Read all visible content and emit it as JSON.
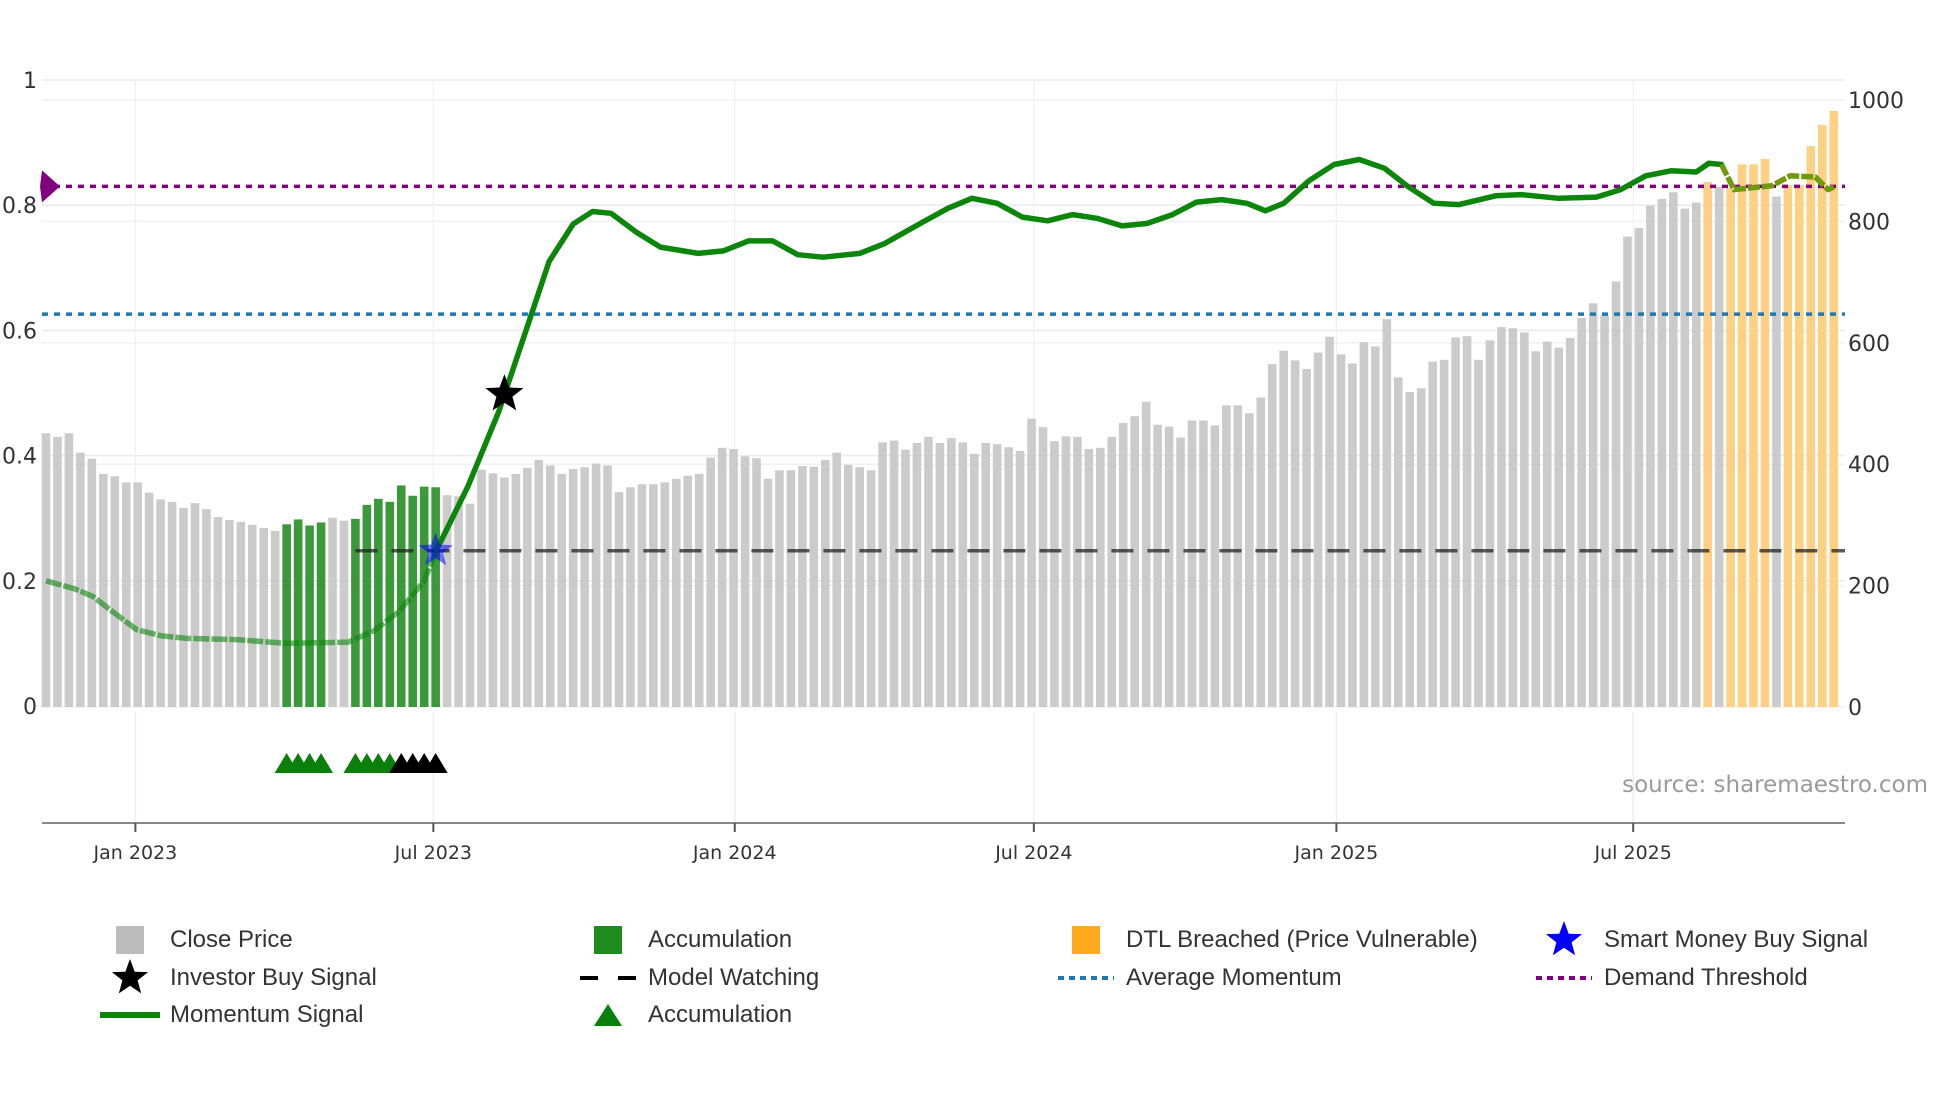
{
  "chart_data": {
    "type": "bar",
    "x_unit": "week index",
    "y_left": {
      "ticks": [
        0,
        0.2,
        0.4,
        0.6,
        0.8,
        1
      ],
      "tick_labels": [
        "0",
        "0.2",
        "0.4",
        "0.6",
        "0.8",
        "1"
      ],
      "range": [
        0,
        1
      ]
    },
    "y_right": {
      "ticks": [
        0,
        200,
        400,
        600,
        800,
        1000
      ],
      "tick_labels": [
        "0",
        "200",
        "400",
        "600",
        "800",
        "1000"
      ],
      "range": [
        0,
        1000
      ]
    },
    "x_ticks": [
      {
        "label": "Jan 2023",
        "pos": 7.8
      },
      {
        "label": "Jul 2023",
        "pos": 33.8
      },
      {
        "label": "Jan 2024",
        "pos": 60.1
      },
      {
        "label": "Jul 2024",
        "pos": 86.2
      },
      {
        "label": "Jan 2025",
        "pos": 112.6
      },
      {
        "label": "Jul 2025",
        "pos": 138.5
      }
    ],
    "close_price": [
      451,
      445,
      451,
      419,
      409,
      384,
      380,
      370,
      370,
      353,
      342,
      338,
      328,
      336,
      326,
      313,
      308,
      305,
      300,
      295,
      290,
      301,
      309,
      299,
      304,
      312,
      307,
      310,
      333,
      343,
      338,
      365,
      348,
      363,
      362,
      349,
      347,
      335,
      391,
      385,
      378,
      384,
      394,
      407,
      398,
      384,
      392,
      395,
      401,
      398,
      354,
      362,
      367,
      367,
      370,
      376,
      381,
      384,
      411,
      427,
      425,
      413,
      410,
      376,
      390,
      390,
      397,
      396,
      407,
      419,
      399,
      395,
      390,
      436,
      439,
      424,
      435,
      445,
      435,
      443,
      436,
      417,
      435,
      433,
      428,
      422,
      475,
      461,
      438,
      446,
      445,
      425,
      427,
      445,
      468,
      479,
      503,
      465,
      462,
      444,
      472,
      472,
      464,
      497,
      497,
      484,
      510,
      565,
      587,
      571,
      557,
      584,
      610,
      581,
      566,
      601,
      594,
      639,
      543,
      519,
      525,
      569,
      572,
      609,
      611,
      572,
      604,
      626,
      624,
      617,
      586,
      602,
      592,
      608,
      641,
      665,
      645,
      701,
      775,
      789,
      826,
      837,
      848,
      821,
      831,
      865,
      857,
      855,
      894,
      894,
      903,
      841,
      860,
      860,
      924,
      959,
      982
    ],
    "accumulation_bars": [
      21,
      22,
      23,
      24,
      27,
      28,
      29,
      30,
      31,
      32,
      33,
      34
    ],
    "dtl_breached_bars": [
      145,
      147,
      148,
      149,
      150,
      152,
      153,
      154,
      155,
      156
    ],
    "momentum": {
      "x": [
        0,
        2.5,
        4.1,
        5.8,
        7.9,
        10.1,
        12.3,
        16.6,
        21,
        26.4,
        28.6,
        30.8,
        33,
        34.1,
        36.8,
        39.5,
        41.7,
        43.9,
        46,
        47.7,
        49.3,
        51.5,
        53.6,
        56.9,
        59.1,
        61.3,
        63.4,
        65.6,
        67.8,
        71,
        73.2,
        76.5,
        78.7,
        80.8,
        83,
        85.2,
        87.4,
        89.6,
        91.7,
        93.9,
        96.1,
        98.3,
        100.4,
        102.6,
        104.8,
        106.4,
        108,
        110.2,
        112.4,
        114.6,
        116.8,
        118.9,
        121.1,
        123.3,
        126.5,
        128.7,
        132,
        135.3,
        137.4,
        139.6,
        141.8,
        144,
        145.1,
        146.2,
        147.3,
        149.5,
        150.6,
        152.2,
        154.4,
        155.5,
        156
      ],
      "y": [
        0.2,
        0.187,
        0.175,
        0.151,
        0.122,
        0.112,
        0.108,
        0.106,
        0.1,
        0.102,
        0.12,
        0.151,
        0.2,
        0.25,
        0.35,
        0.47,
        0.59,
        0.71,
        0.77,
        0.79,
        0.787,
        0.757,
        0.733,
        0.723,
        0.727,
        0.743,
        0.743,
        0.721,
        0.717,
        0.723,
        0.739,
        0.773,
        0.795,
        0.811,
        0.803,
        0.781,
        0.775,
        0.785,
        0.779,
        0.767,
        0.771,
        0.785,
        0.805,
        0.809,
        0.803,
        0.791,
        0.803,
        0.839,
        0.865,
        0.873,
        0.859,
        0.829,
        0.803,
        0.801,
        0.815,
        0.817,
        0.811,
        0.813,
        0.825,
        0.847,
        0.855,
        0.853,
        0.867,
        0.865,
        0.825,
        0.829,
        0.831,
        0.847,
        0.845,
        0.825,
        0.829
      ],
      "faded_until": 34.1,
      "olive_from": 146.2
    },
    "average_momentum": 0.626,
    "demand_threshold": 0.83,
    "model_watching": {
      "value": 0.248,
      "from": 27
    },
    "investor_buy_signal": {
      "x": 40,
      "y": 0.498
    },
    "smart_money_buy_signal": {
      "x": 34,
      "y": 0.248
    },
    "accumulation_triangles": [
      21,
      22,
      23,
      24,
      27,
      28,
      29,
      30
    ],
    "investor_triangles": [
      31,
      32,
      33,
      34
    ],
    "source": "source: sharemaestro.com",
    "legend": [
      {
        "label": "Close Price",
        "icon": "grey-square"
      },
      {
        "label": "Investor Buy Signal",
        "icon": "black-star"
      },
      {
        "label": "Momentum Signal",
        "icon": "green-line"
      },
      {
        "label": "Accumulation",
        "icon": "green-square"
      },
      {
        "label": "Model Watching",
        "icon": "black-dash"
      },
      {
        "label": "Accumulation",
        "icon": "green-triangle"
      },
      {
        "label": "DTL Breached (Price Vulnerable)",
        "icon": "orange-square"
      },
      {
        "label": "Average Momentum",
        "icon": "blue-dotted"
      },
      {
        "label": "Smart Money Buy Signal",
        "icon": "blue-star"
      },
      {
        "label": "Demand Threshold",
        "icon": "purple-dotted"
      }
    ],
    "colors": {
      "close": "#c8c8c8",
      "accumulation": "#2a902a",
      "dtl": "#fdd083",
      "dtl_legend": "#ffa91f",
      "momentum": "#0b860b",
      "olive": "#6f9a0e",
      "avg": "#1f77b4",
      "demand": "#800080",
      "watch": "#222222",
      "smart": "#0000ff"
    }
  }
}
